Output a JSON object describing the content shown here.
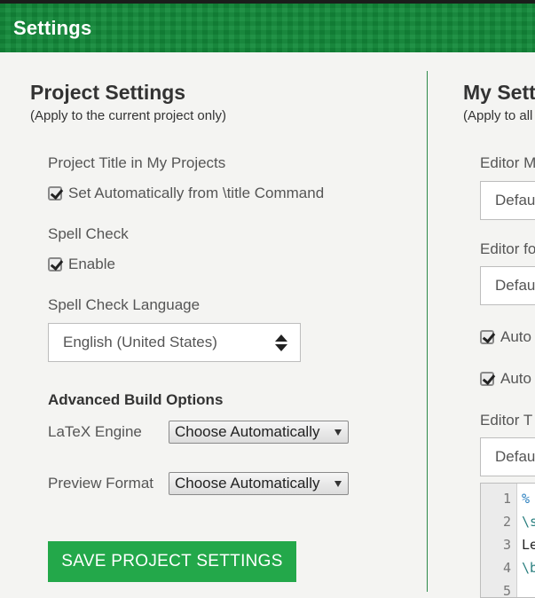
{
  "header": {
    "title": "Settings"
  },
  "project": {
    "title": "Project Settings",
    "subtitle": "(Apply to the current project only)",
    "title_in_projects": {
      "label": "Project Title in My Projects",
      "checkbox_label": "Set Automatically from \\title Command",
      "checked": true
    },
    "spell_check": {
      "label": "Spell Check",
      "checkbox_label": "Enable",
      "checked": true
    },
    "spell_language": {
      "label": "Spell Check Language",
      "value": "English (United States)"
    },
    "advanced": {
      "title": "Advanced Build Options",
      "latex_engine": {
        "label": "LaTeX Engine",
        "value": "Choose Automatically"
      },
      "preview_format": {
        "label": "Preview Format",
        "value": "Choose Automatically"
      }
    },
    "save_label": "SAVE PROJECT SETTINGS"
  },
  "my_settings": {
    "title": "My Sett",
    "subtitle": "(Apply to all",
    "editor_mode": {
      "label": "Editor M",
      "value": "Defau"
    },
    "editor_font": {
      "label": "Editor fo",
      "value": "Defau"
    },
    "auto1": {
      "label": "Auto",
      "checked": true
    },
    "auto2": {
      "label": "Auto",
      "checked": true
    },
    "editor_theme": {
      "label": "Editor T",
      "value": "Defau"
    },
    "code_lines": [
      {
        "num": "1",
        "text": "%",
        "color": "#2a7fbf"
      },
      {
        "num": "2",
        "text": "\\s",
        "color": "#2a7f7f"
      },
      {
        "num": "3",
        "text": "Le",
        "color": "#222222"
      },
      {
        "num": "4",
        "text": "\\b",
        "color": "#2a7f7f"
      },
      {
        "num": "5",
        "text": "",
        "color": "#222222"
      }
    ]
  },
  "colors": {
    "header_green": "#138a3a",
    "button_green": "#23a84a",
    "divider_green": "#2d8a4a"
  }
}
